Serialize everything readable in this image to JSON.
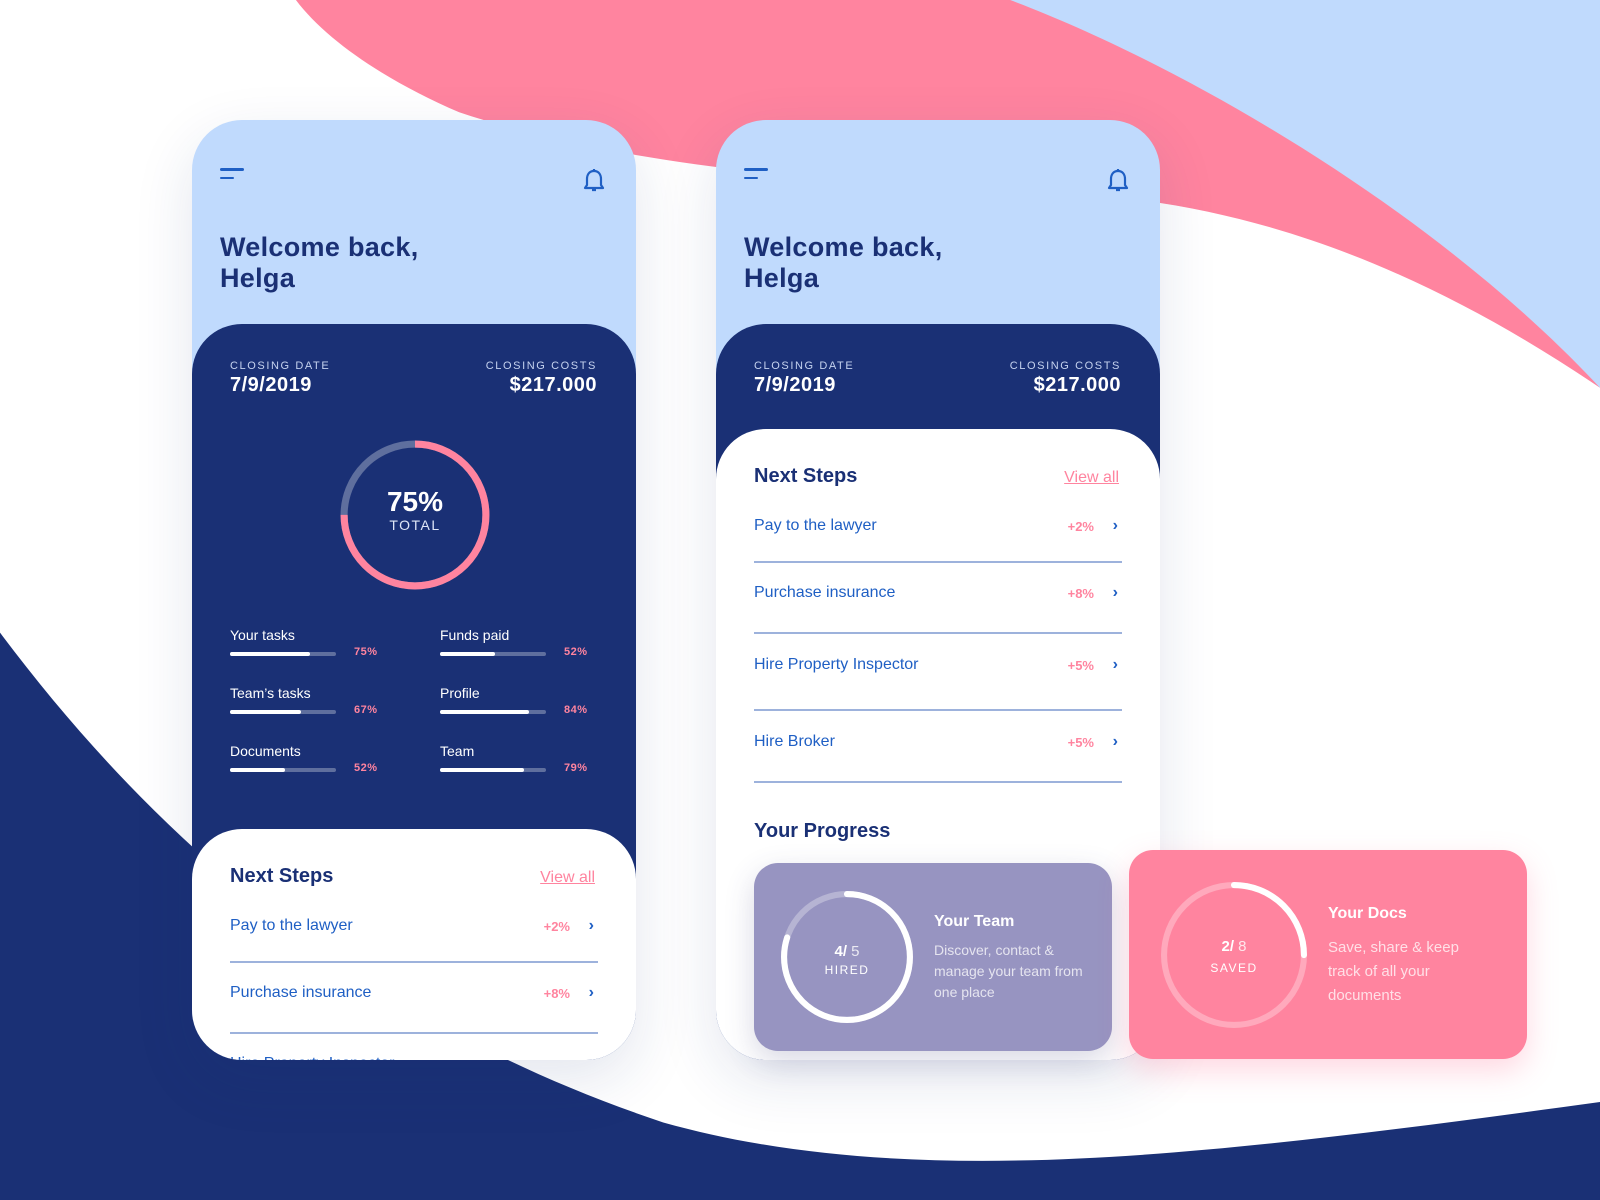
{
  "colors": {
    "navy": "#1a3075",
    "light_blue": "#c0dafd",
    "pink": "#ff849f",
    "purple": "#9794c1",
    "link_blue": "#1f5fc4"
  },
  "header": {
    "title_line1": "Welcome back,",
    "title_line2": "Helga",
    "menu_icon": "hamburger-icon",
    "bell_icon": "bell-icon"
  },
  "summary": {
    "closing_date_label": "CLOSING DATE",
    "closing_date": "7/9/2019",
    "closing_costs_label": "CLOSING COSTS",
    "closing_costs": "$217.000"
  },
  "total": {
    "value": "75%",
    "label": "TOTAL",
    "percent": 75
  },
  "stats": [
    {
      "label": "Your tasks",
      "pct": "75%",
      "value": 75
    },
    {
      "label": "Funds paid",
      "pct": "52%",
      "value": 52
    },
    {
      "label": "Team’s tasks",
      "pct": "67%",
      "value": 67
    },
    {
      "label": "Profile",
      "pct": "84%",
      "value": 84
    },
    {
      "label": "Documents",
      "pct": "52%",
      "value": 52
    },
    {
      "label": "Team",
      "pct": "79%",
      "value": 79
    }
  ],
  "next_steps": {
    "title": "Next Steps",
    "view_all": "View all",
    "items": [
      {
        "label": "Pay to the lawyer",
        "pct": "+2%"
      },
      {
        "label": "Purchase insurance",
        "pct": "+8%"
      },
      {
        "label": "Hire Property Inspector",
        "pct": "+5%"
      },
      {
        "label": "Hire Broker",
        "pct": "+5%"
      }
    ]
  },
  "progress": {
    "title": "Your Progress",
    "team": {
      "count": "4/",
      "total": "5",
      "label": "HIRED",
      "fraction": 0.8,
      "title": "Your Team",
      "desc": "Discover, contact & manage your team from one place"
    },
    "docs": {
      "count": "2/",
      "total": "8",
      "label": "SAVED",
      "fraction": 0.25,
      "title": "Your Docs",
      "desc": "Save, share & keep track of all your documents"
    }
  }
}
